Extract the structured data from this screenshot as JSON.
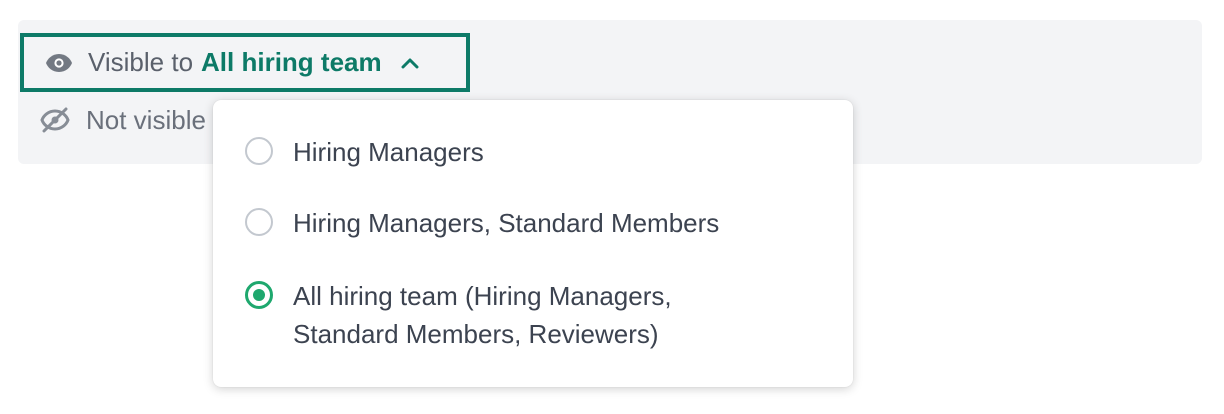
{
  "visibility": {
    "prefix": "Visible to",
    "selected": "All hiring team",
    "not_visible_text": "Not visible"
  },
  "icons": {
    "eye": "eye-icon",
    "eye_off": "eye-off-icon",
    "chevron": "chevron-up-icon"
  },
  "colors": {
    "accent": "#0d7a67",
    "radio_checked": "#1ea86e",
    "panel_bg": "#f3f4f6"
  },
  "dropdown": {
    "options": [
      {
        "label": "Hiring Managers",
        "checked": false
      },
      {
        "label": "Hiring Managers, Standard Members",
        "checked": false
      },
      {
        "label": "All hiring team (Hiring Managers,\nStandard Members, Reviewers)",
        "checked": true
      }
    ]
  }
}
